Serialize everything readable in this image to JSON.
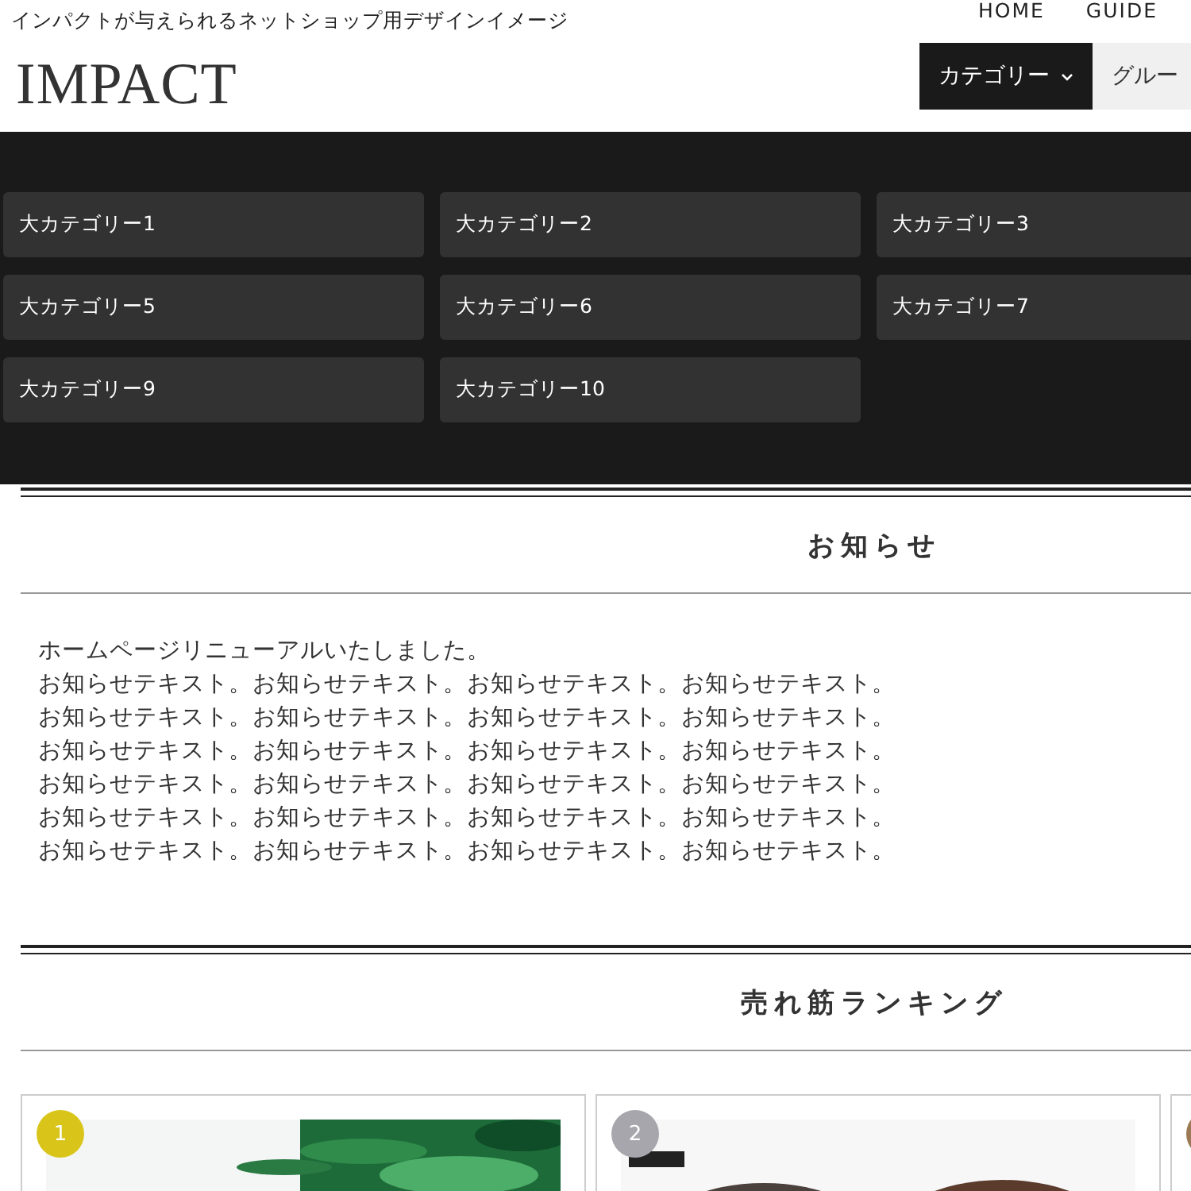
{
  "header": {
    "tagline": "インパクトが与えられるネットショップ用デザインイメージ",
    "logo": "IMPACT",
    "links": [
      "HOME",
      "GUIDE"
    ],
    "nav": [
      {
        "label": "カテゴリー",
        "caret": true,
        "selected": true
      },
      {
        "label": "グルー",
        "caret": false,
        "selected": false
      }
    ]
  },
  "mega_menu": {
    "items": [
      {
        "label": "大カテゴリー1"
      },
      {
        "label": "大カテゴリー2"
      },
      {
        "label": "大カテゴリー3"
      },
      {
        "label": "大カテゴリー5"
      },
      {
        "label": "大カテゴリー6"
      },
      {
        "label": "大カテゴリー7"
      },
      {
        "label": "大カテゴリー9"
      },
      {
        "label": "大カテゴリー10"
      }
    ]
  },
  "news": {
    "title": "お知らせ",
    "lines": [
      "ホームページリニューアルいたしました。",
      "お知らせテキスト。お知らせテキスト。お知らせテキスト。お知らせテキスト。",
      "お知らせテキスト。お知らせテキスト。お知らせテキスト。お知らせテキスト。",
      "お知らせテキスト。お知らせテキスト。お知らせテキスト。お知らせテキスト。",
      "お知らせテキスト。お知らせテキスト。お知らせテキスト。お知らせテキスト。",
      "お知らせテキスト。お知らせテキスト。お知らせテキスト。お知らせテキスト。",
      "お知らせテキスト。お知らせテキスト。お知らせテキスト。お知らせテキスト。"
    ]
  },
  "ranking": {
    "title": "売れ筋ランキング",
    "cards": [
      {
        "rank": "1",
        "color": "#d9c51a",
        "kind": "picture"
      },
      {
        "rank": "2",
        "color": "#a8a6ad",
        "kind": "picture"
      },
      {
        "color": "#9c7a55"
      }
    ]
  }
}
